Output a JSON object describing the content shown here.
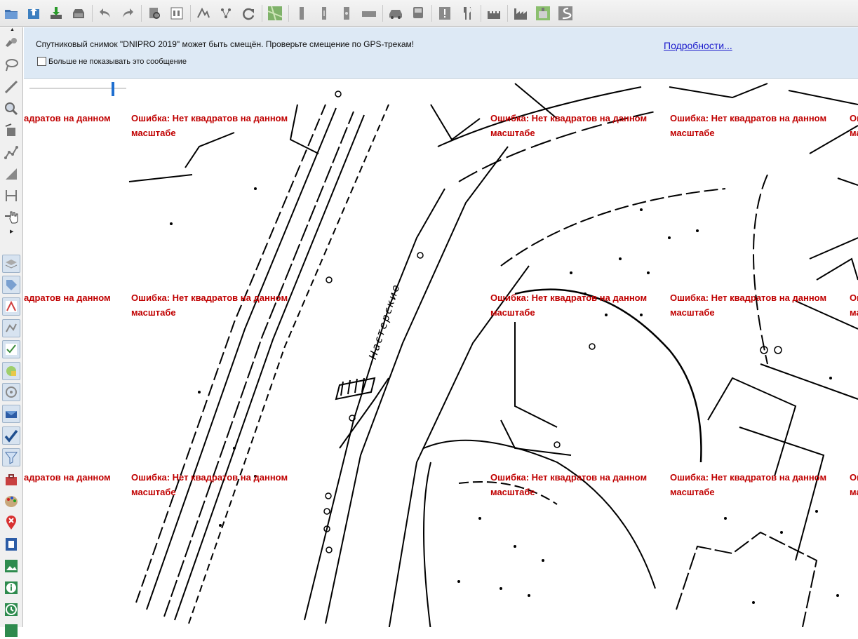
{
  "toolbar": {
    "icons": [
      "open-icon",
      "upload-icon",
      "download-icon",
      "save-icon",
      "undo-icon",
      "redo-icon",
      "find-icon",
      "properties-icon",
      "audit-icon",
      "tree-icon",
      "refresh-icon",
      "map-tile-icon",
      "rail-icon",
      "rail2-icon",
      "rail3-icon",
      "road-icon",
      "car-icon",
      "bus-icon",
      "warning-icon",
      "restaurant-icon",
      "castle-icon",
      "factory-icon",
      "landfill-icon",
      "route-icon"
    ]
  },
  "notice": {
    "message": "Спутниковый снимок \"DNIPRO 2019\" может быть смещён. Проверьте смещение по GPS-трекам!",
    "details_link": "Подробности...",
    "checkbox_label": "Больше не показывать это сообщение",
    "checkbox_checked": false
  },
  "map": {
    "tile_error_line1": "Ошибка: Нет квадратов на данном",
    "tile_error_line2": "масштабе",
    "tile_error_partial": "адратов на данном",
    "street_label": "Настерские",
    "zoom_level_fraction": 0.86
  },
  "colors": {
    "error_text": "#c00000",
    "notice_bg": "#dde9f5",
    "link": "#1a1acc",
    "accent": "#1f6fd0"
  }
}
